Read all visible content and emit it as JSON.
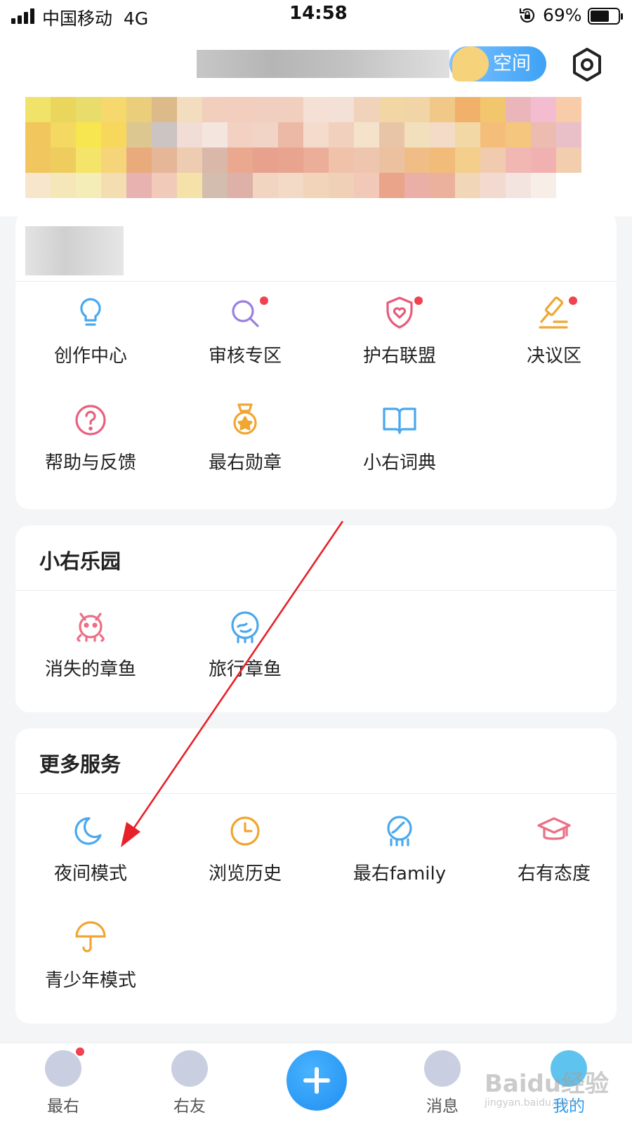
{
  "status_bar": {
    "carrier": "中国移动",
    "network": "4G",
    "time": "14:58",
    "battery": "69%",
    "battery_level": 0.69
  },
  "header": {
    "space_label": "空间"
  },
  "profile_grid": [
    {
      "label": "创作中心",
      "icon": "lightbulb-icon",
      "color": "#4aa8ee",
      "dot": false
    },
    {
      "label": "审核专区",
      "icon": "magnifier-icon",
      "color": "#9b7fe0",
      "dot": true
    },
    {
      "label": "护右联盟",
      "icon": "shield-heart-icon",
      "color": "#e85a7a",
      "dot": true
    },
    {
      "label": "决议区",
      "icon": "gavel-icon",
      "color": "#f0a631",
      "dot": true
    },
    {
      "label": "帮助与反馈",
      "icon": "question-icon",
      "color": "#e8607e",
      "dot": false
    },
    {
      "label": "最右勋章",
      "icon": "medal-icon",
      "color": "#f0a631",
      "dot": false
    },
    {
      "label": "小右词典",
      "icon": "book-icon",
      "color": "#4aa8ee",
      "dot": false
    }
  ],
  "park": {
    "title": "小右乐园",
    "items": [
      {
        "label": "消失的章鱼",
        "icon": "octopus-icon",
        "color": "#ec6f86"
      },
      {
        "label": "旅行章鱼",
        "icon": "travel-octopus-icon",
        "color": "#4aa8ee"
      }
    ]
  },
  "more": {
    "title": "更多服务",
    "items": [
      {
        "label": "夜间模式",
        "icon": "moon-icon",
        "color": "#4aa8ee"
      },
      {
        "label": "浏览历史",
        "icon": "clock-icon",
        "color": "#f0a631"
      },
      {
        "label": "最右family",
        "icon": "family-icon",
        "color": "#4aa8ee"
      },
      {
        "label": "右有态度",
        "icon": "graduation-cap-icon",
        "color": "#ec6f86"
      },
      {
        "label": "青少年模式",
        "icon": "umbrella-icon",
        "color": "#f0a631"
      }
    ]
  },
  "tabs": [
    {
      "label": "最右",
      "dot": true
    },
    {
      "label": "右友",
      "dot": false
    },
    {
      "label": "消息",
      "dot": false
    },
    {
      "label": "我的",
      "dot": false,
      "active": true
    }
  ],
  "watermark": {
    "text": "Baidu经验",
    "sub": "jingyan.baidu.com"
  }
}
